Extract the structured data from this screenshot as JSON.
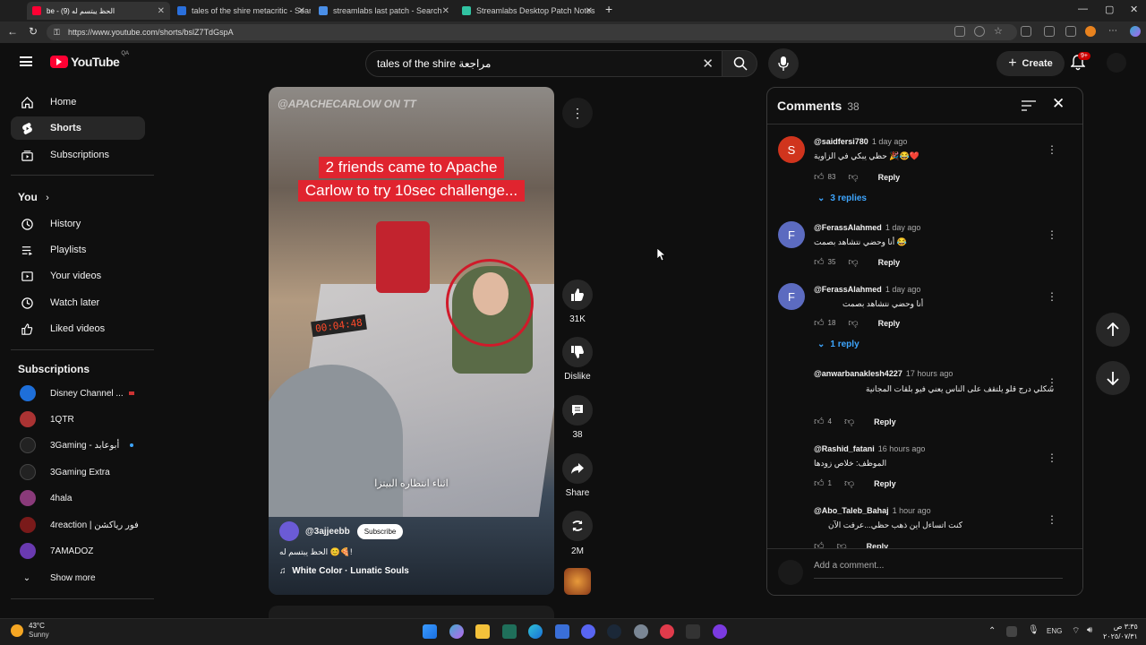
{
  "browser": {
    "tabs": [
      {
        "title": "be - الحظ يبتسم له (9)"
      },
      {
        "title": "tales of the shire metacritic - Sear"
      },
      {
        "title": "streamlabs last patch - Search"
      },
      {
        "title": "Streamlabs Desktop Patch Notes"
      }
    ],
    "url": "https://www.youtube.com/shorts/bslZ7TdGspA"
  },
  "header": {
    "logo_text": "YouTube",
    "region": "QA",
    "search_query": "tales of the shire مراجعة",
    "create_label": "Create",
    "notif_count": "9+"
  },
  "sidebar": {
    "main": [
      {
        "label": "Home",
        "icon": "home-icon"
      },
      {
        "label": "Shorts",
        "icon": "shorts-icon"
      },
      {
        "label": "Subscriptions",
        "icon": "subscriptions-icon"
      }
    ],
    "you_heading": "You",
    "you_items": [
      {
        "label": "History",
        "icon": "history-icon"
      },
      {
        "label": "Playlists",
        "icon": "playlists-icon"
      },
      {
        "label": "Your videos",
        "icon": "your-videos-icon"
      },
      {
        "label": "Watch later",
        "icon": "watch-later-icon"
      },
      {
        "label": "Liked videos",
        "icon": "liked-videos-icon"
      }
    ],
    "subs_heading": "Subscriptions",
    "subs": [
      {
        "label": "Disney Channel ...",
        "color": "#1e6fd9"
      },
      {
        "label": "1QTR",
        "color": "#a33"
      },
      {
        "label": "3Gaming - أبوعابد",
        "color": "#222"
      },
      {
        "label": "3Gaming Extra",
        "color": "#222"
      },
      {
        "label": "4hala",
        "color": "#8a3a7a"
      },
      {
        "label": "4reaction | فور رياكشن",
        "color": "#7a1a1a"
      },
      {
        "label": "7AMADOZ",
        "color": "#6a3ab0"
      }
    ],
    "show_more": "Show more"
  },
  "video": {
    "watermark": "@APACHECARLOW ON TT",
    "caption_line1": "2 friends came to Apache",
    "caption_line2": "Carlow to try 10sec challenge...",
    "timer": "00:04:48",
    "arabic_sub": "اثناء انتظاره البيتزا",
    "channel": "@3ajjeebb",
    "subscribe_label": "Subscribe",
    "title": "الحظ يبتسم له 😊🍕!",
    "music": "White Color · Lunatic Souls"
  },
  "actions": {
    "likes": "31K",
    "dislike_label": "Dislike",
    "comments": "38",
    "share_label": "Share",
    "remix_count": "2M"
  },
  "comments_panel": {
    "title": "Comments",
    "count": "38",
    "reply_label": "Reply",
    "add_placeholder": "Add a comment...",
    "items": [
      {
        "avatar_letter": "S",
        "avatar_color": "#d0341d",
        "author": "@saidfersi780",
        "time": "1 day ago",
        "text": "حظي يبكي في الزاوية 🎉😂❤️",
        "likes": "83",
        "replies": "3 replies"
      },
      {
        "avatar_letter": "F",
        "avatar_color": "#5c6bc0",
        "author": "@FerassAlahmed",
        "time": "1 day ago",
        "text": "أنا وحضي نتشاهد بصمت 😂",
        "likes": "35"
      },
      {
        "avatar_letter": "F",
        "avatar_color": "#5c6bc0",
        "author": "@FerassAlahmed",
        "time": "1 day ago",
        "text": "أنا وحضي نتشاهد بصمت",
        "likes": "18",
        "replies": "1 reply"
      },
      {
        "author": "@anwarbanaklesh4227",
        "time": "17 hours ago",
        "text": "شكلي درج قلو يلتقف على الناس يعني فيو بلقات المجانية",
        "likes": "4"
      },
      {
        "author": "@Rashid_fatani",
        "time": "16 hours ago",
        "text": "الموظف: خلاص زودها",
        "likes": "1"
      },
      {
        "author": "@Abo_Taleb_Bahaj",
        "time": "1 hour ago",
        "text": "كنت اتساءل اين ذهب حظي...عرفت الآن"
      }
    ]
  },
  "taskbar": {
    "temp": "43°C",
    "weather": "Sunny",
    "lang": "ENG",
    "time": "٣:٣٥ ص",
    "date": "٢٠٢٥/٠٧/٣١"
  }
}
